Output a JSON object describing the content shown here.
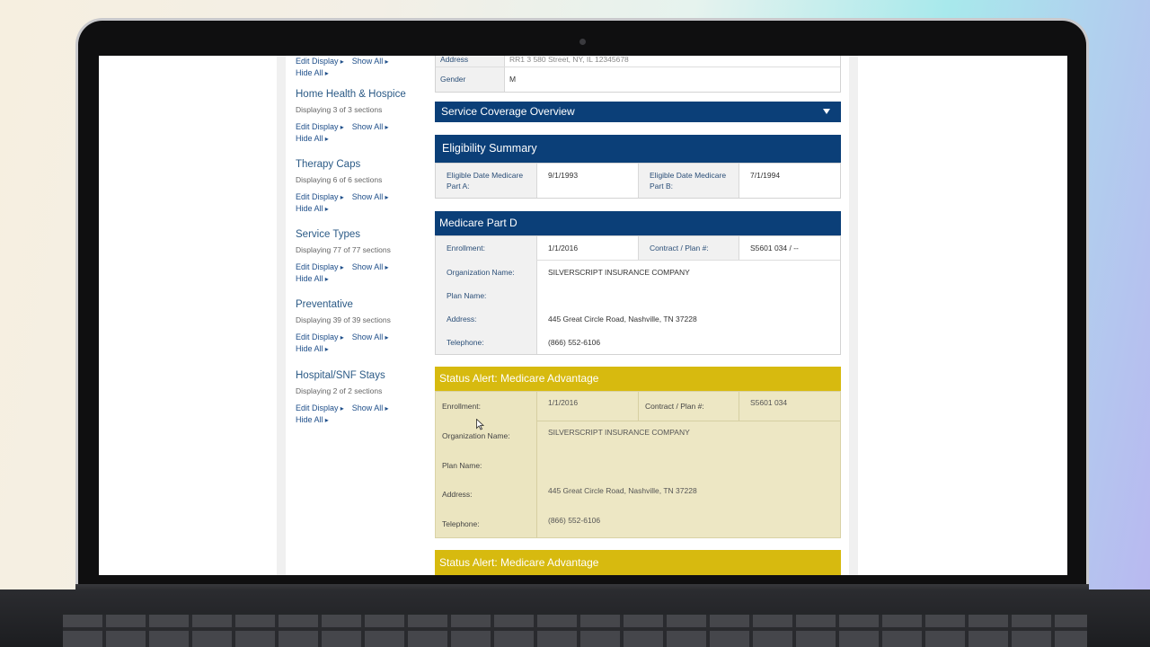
{
  "sidebar": {
    "top_links": {
      "edit": "Edit Display",
      "show": "Show All",
      "hide": "Hide All"
    },
    "sections": [
      {
        "title": "Home Health & Hospice",
        "count": "Displaying 3 of 3 sections"
      },
      {
        "title": "Therapy Caps",
        "count": "Displaying 6 of 6 sections"
      },
      {
        "title": "Service Types",
        "count": "Displaying 77 of 77 sections"
      },
      {
        "title": "Preventative",
        "count": "Displaying 39 of 39 sections"
      },
      {
        "title": "Hospital/SNF Stays",
        "count": "Displaying 2 of 2 sections"
      }
    ]
  },
  "patient": {
    "address_label": "Address",
    "address_value": "RR1 3 580 Street, NY, IL 12345678",
    "gender_label": "Gender",
    "gender_value": "M"
  },
  "coverage_overview": {
    "title": "Service Coverage Overview"
  },
  "eligibility": {
    "title": "Eligibility Summary",
    "part_a_label": "Eligible Date Medicare Part A:",
    "part_a_value": "9/1/1993",
    "part_b_label": "Eligible Date Medicare Part B:",
    "part_b_value": "7/1/1994"
  },
  "part_d": {
    "title": "Medicare Part D",
    "enrollment_label": "Enrollment:",
    "enrollment_value": "1/1/2016",
    "contract_label": "Contract / Plan #:",
    "contract_value": "S5601 034 / --",
    "org_label": "Organization Name:",
    "org_value": "SILVERSCRIPT INSURANCE COMPANY",
    "plan_label": "Plan Name:",
    "address_label": "Address:",
    "address_value": "445 Great Circle Road, Nashville, TN 37228",
    "phone_label": "Telephone:",
    "phone_value": "(866) 552-6106"
  },
  "alert1": {
    "title": "Status Alert: Medicare Advantage",
    "enrollment_label": "Enrollment:",
    "enrollment_value": "1/1/2016",
    "contract_label": "Contract / Plan #:",
    "contract_value": "S5601 034",
    "org_label": "Organization Name:",
    "org_value": "SILVERSCRIPT INSURANCE COMPANY",
    "plan_label": "Plan Name:",
    "address_label": "Address:",
    "address_value": "445 Great Circle Road, Nashville, TN 37228",
    "phone_label": "Telephone:",
    "phone_value": "(866) 552-6106"
  },
  "alert2": {
    "title": "Status Alert: Medicare Advantage"
  },
  "colors": {
    "header_blue": "#0b3f78",
    "alert_yellow": "#d7ba0f",
    "link_blue": "#1f4f8a"
  }
}
